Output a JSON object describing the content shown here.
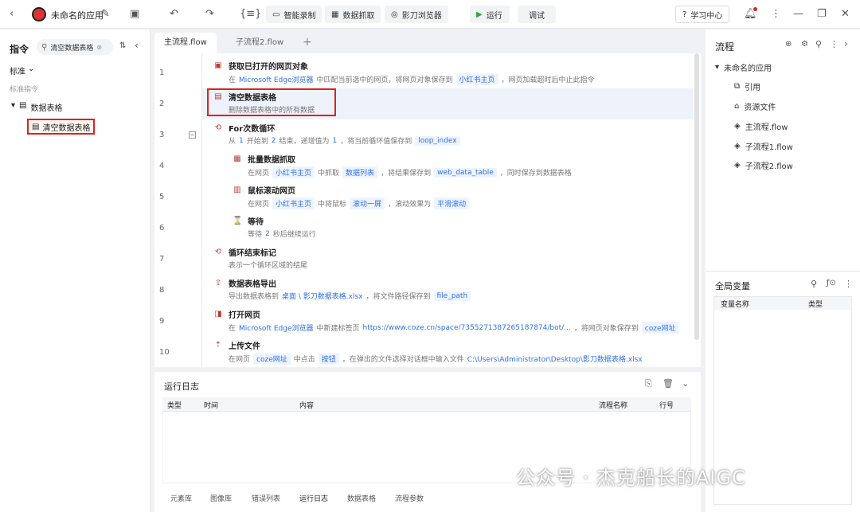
{
  "toolbar": {
    "app_name": "未命名的应用",
    "smart_record": "智能录制",
    "data_capture": "数据抓取",
    "browser": "影刀浏览器",
    "run": "运行",
    "debug": "调试",
    "learning": "学习中心"
  },
  "left": {
    "title": "指令",
    "search_value": "清空数据表格",
    "filter_label": "标准",
    "section_label": "标准指令",
    "tree_group": "数据表格",
    "tree_item": "清空数据表格"
  },
  "tabs": [
    "主流程.flow",
    "子流程2.flow"
  ],
  "steps": [
    {
      "num": "1",
      "title": "获取已打开的网页对象",
      "desc": [
        "在",
        "Microsoft Edge浏览器",
        "中匹配当前选中的网页，将网页对象保存到",
        "小红书主页",
        "，网页加载超时后中止此指令"
      ]
    },
    {
      "num": "2",
      "title": "清空数据表格",
      "desc": [
        "删除数据表格中的所有数据"
      ]
    },
    {
      "num": "3",
      "title": "For次数循环",
      "desc": [
        "从",
        "1",
        "开始到",
        "2",
        "结束，递增值为",
        "1",
        "，将当前循环值保存到",
        "loop_index"
      ]
    },
    {
      "num": "4",
      "title": "批量数据抓取",
      "desc": [
        "在网页",
        "小红书主页",
        "中抓取",
        "数据列表",
        "，将结果保存到",
        "web_data_table",
        "，同时保存到数据表格"
      ]
    },
    {
      "num": "5",
      "title": "鼠标滚动网页",
      "desc": [
        "在网页",
        "小红书主页",
        "中将鼠标",
        "滚动一屏",
        "，滚动效果为",
        "平滑滚动"
      ]
    },
    {
      "num": "6",
      "title": "等待",
      "desc": [
        "等待",
        "2",
        "秒后继续运行"
      ]
    },
    {
      "num": "7",
      "title": "循环结束标记",
      "desc": [
        "表示一个循环区域的结尾"
      ]
    },
    {
      "num": "8",
      "title": "数据表格导出",
      "desc": [
        "导出数据表格到",
        "桌面 \\ 影刀数据表格.xlsx",
        "，将文件路径保存到",
        "file_path"
      ]
    },
    {
      "num": "9",
      "title": "打开网页",
      "desc": [
        "在",
        "Microsoft Edge浏览器",
        "中新建标签页",
        "https://www.coze.cn/space/7355271387265187874/bot/...",
        "，将网页对象保存到",
        "coze网址"
      ]
    },
    {
      "num": "10",
      "title": "上传文件",
      "desc": [
        "在网页",
        "coze网址",
        "中点击",
        "按钮",
        "，在弹出的文件选择对话框中输入文件",
        "C:\\Users\\Administrator\\Desktop\\影刀数据表格.xlsx"
      ]
    }
  ],
  "right": {
    "title": "流程",
    "app": "未命名的应用",
    "items": [
      "引用",
      "资源文件",
      "主流程.flow",
      "子流程1.flow",
      "子流程2.flow"
    ],
    "global_vars": "全局变量",
    "col_name": "变量名称",
    "col_type": "类型"
  },
  "log": {
    "title": "运行日志",
    "columns": [
      "类型",
      "时间",
      "内容",
      "流程名称",
      "行号"
    ],
    "bottom_tabs": [
      "元素库",
      "图像库",
      "错误列表",
      "运行日志",
      "数据表格",
      "流程参数"
    ]
  },
  "watermark": "公众号 · 杰克船长的AIGC",
  "colors": {
    "accent": "#2f6fed",
    "highlight": "#e02020",
    "run": "#2aa745"
  }
}
